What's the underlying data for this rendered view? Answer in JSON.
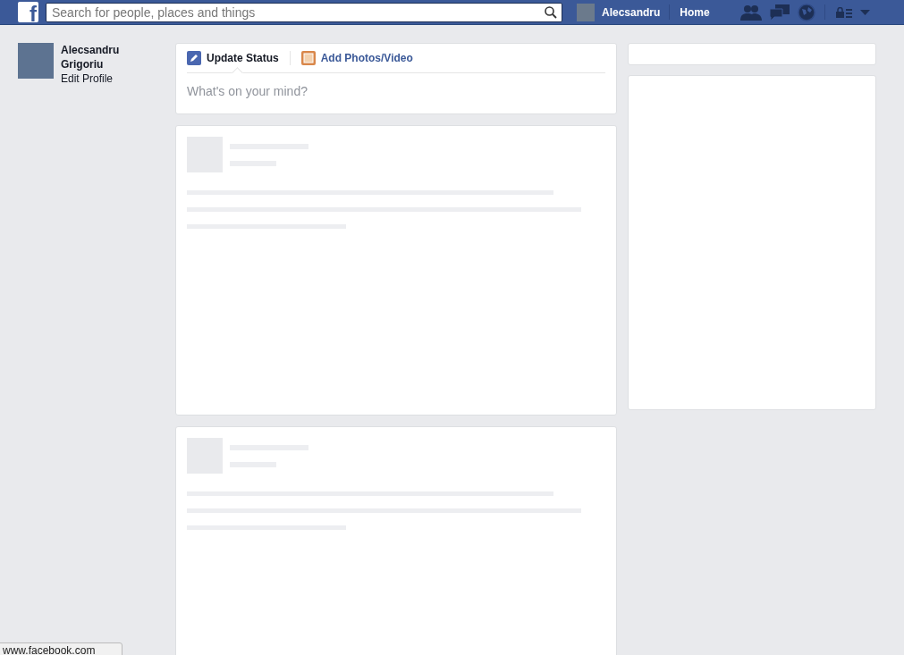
{
  "topbar": {
    "logo": "f",
    "search": {
      "placeholder": "Search for people, places and things"
    },
    "user": "Alecsandru",
    "home": "Home"
  },
  "sidebar": {
    "name": "Alecsandru Grigoriu",
    "edit": "Edit Profile"
  },
  "composer": {
    "tabs": [
      {
        "label": "Update Status",
        "kind": "status",
        "selected": true
      },
      {
        "label": "Add Photos/Video",
        "kind": "photo",
        "selected": false
      }
    ],
    "placeholder": "What's on your mind?"
  },
  "feed": {
    "cards": [
      {
        "kind": "loading"
      },
      {
        "kind": "loading"
      }
    ]
  },
  "status_bar": "www.facebook.com"
}
